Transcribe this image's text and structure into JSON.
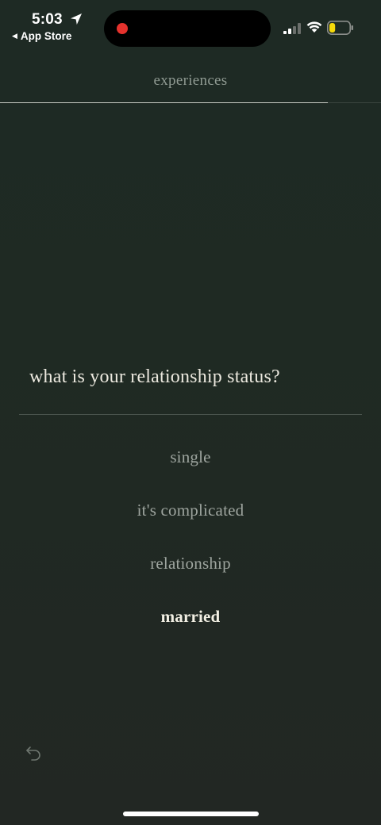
{
  "status_bar": {
    "time": "5:03",
    "back_app": "App Store",
    "battery_level": 0.3,
    "battery_color": "#f5d90a",
    "recording_color": "#e5322d"
  },
  "header": {
    "title": "experiences",
    "progress": 0.86
  },
  "question": {
    "text": "what is your relationship status?"
  },
  "options": [
    {
      "label": "single",
      "selected": false
    },
    {
      "label": "it's complicated",
      "selected": false
    },
    {
      "label": "relationship",
      "selected": false
    },
    {
      "label": "married",
      "selected": true
    }
  ],
  "icons": {
    "location": "location-arrow-icon",
    "signal": "cellular-signal-icon",
    "wifi": "wifi-icon",
    "battery": "battery-icon",
    "undo": "undo-icon"
  }
}
